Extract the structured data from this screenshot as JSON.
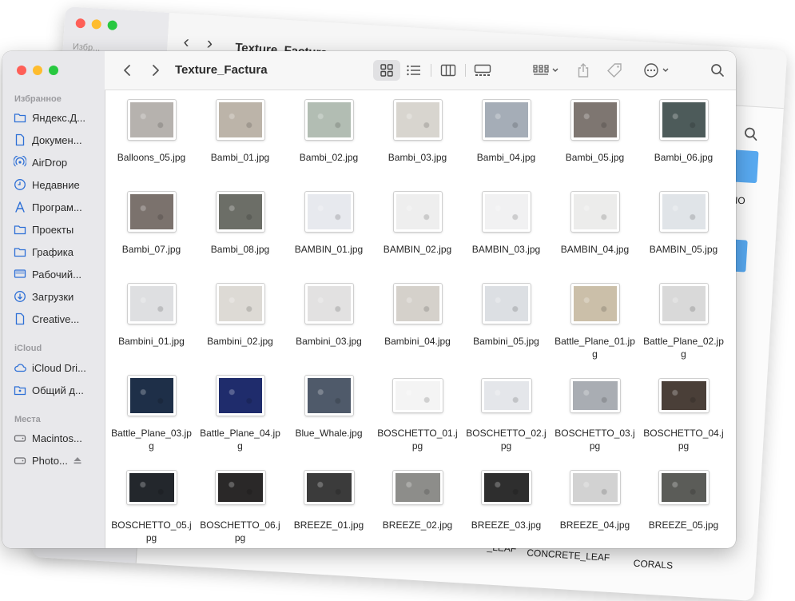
{
  "background_window": {
    "title": "Texture_Factura",
    "sidebar_label": "Избр...",
    "labels": [
      ".MIO",
      "CONCRETE_LEAF",
      "CORALS",
      "_LEAF"
    ]
  },
  "window": {
    "title": "Texture_Factura"
  },
  "sidebar": {
    "favorites_header": "Избранное",
    "favorites": [
      {
        "label": "Яндекс.Д...",
        "icon": "folder-icon"
      },
      {
        "label": "Докумен...",
        "icon": "document-icon"
      },
      {
        "label": "AirDrop",
        "icon": "airdrop-icon"
      },
      {
        "label": "Недавние",
        "icon": "clock-icon"
      },
      {
        "label": "Програм...",
        "icon": "applications-icon"
      },
      {
        "label": "Проекты",
        "icon": "folder-icon"
      },
      {
        "label": "Графика",
        "icon": "folder-icon"
      },
      {
        "label": "Рабочий...",
        "icon": "desktop-icon"
      },
      {
        "label": "Загрузки",
        "icon": "download-icon"
      },
      {
        "label": "Creative...",
        "icon": "document-icon"
      }
    ],
    "icloud_header": "iCloud",
    "icloud": [
      {
        "label": "iCloud Dri...",
        "icon": "cloud-icon"
      },
      {
        "label": "Общий д...",
        "icon": "shared-folder-icon"
      }
    ],
    "places_header": "Места",
    "places": [
      {
        "label": "Macintos...",
        "icon": "disk-icon"
      },
      {
        "label": "Photo...",
        "icon": "disk-icon"
      }
    ]
  },
  "files": [
    {
      "name": "Balloons_05.jpg",
      "color": "#b6b2ae"
    },
    {
      "name": "Bambi_01.jpg",
      "color": "#bcb4a9"
    },
    {
      "name": "Bambi_02.jpg",
      "color": "#b2bdb3"
    },
    {
      "name": "Bambi_03.jpg",
      "color": "#d8d5cf"
    },
    {
      "name": "Bambi_04.jpg",
      "color": "#a5adb7"
    },
    {
      "name": "Bambi_05.jpg",
      "color": "#7e7671"
    },
    {
      "name": "Bambi_06.jpg",
      "color": "#4d5b5a"
    },
    {
      "name": "Bambi_07.jpg",
      "color": "#7b726d"
    },
    {
      "name": "Bambi_08.jpg",
      "color": "#6c6e67"
    },
    {
      "name": "BAMBIN_01.jpg",
      "color": "#e7e9ee"
    },
    {
      "name": "BAMBIN_02.jpg",
      "color": "#eeeeee"
    },
    {
      "name": "BAMBIN_03.jpg",
      "color": "#f1f1f2"
    },
    {
      "name": "BAMBIN_04.jpg",
      "color": "#ececeb"
    },
    {
      "name": "BAMBIN_05.jpg",
      "color": "#e0e4e8"
    },
    {
      "name": "Bambini_01.jpg",
      "color": "#dedfe1"
    },
    {
      "name": "Bambini_02.jpg",
      "color": "#dddad5"
    },
    {
      "name": "Bambini_03.jpg",
      "color": "#e2e1e1"
    },
    {
      "name": "Bambini_04.jpg",
      "color": "#d5d1cb"
    },
    {
      "name": "Bambini_05.jpg",
      "color": "#dcdfe3"
    },
    {
      "name": "Battle_Plane_01.jpg",
      "color": "#cbbfa9"
    },
    {
      "name": "Battle_Plane_02.jpg",
      "color": "#d9d9d9"
    },
    {
      "name": "Battle_Plane_03.jpg",
      "color": "#1e2f48"
    },
    {
      "name": "Battle_Plane_04.jpg",
      "color": "#1f2c6c"
    },
    {
      "name": "Blue_Whale.jpg",
      "color": "#4f5a6a"
    },
    {
      "name": "BOSCHETTO_01.jpg",
      "color": "#f4f4f4"
    },
    {
      "name": "BOSCHETTO_02.jpg",
      "color": "#e4e6ea"
    },
    {
      "name": "BOSCHETTO_03.jpg",
      "color": "#a9adb3"
    },
    {
      "name": "BOSCHETTO_04.jpg",
      "color": "#4a3f38"
    },
    {
      "name": "BOSCHETTO_05.jpg",
      "color": "#23272c"
    },
    {
      "name": "BOSCHETTO_06.jpg",
      "color": "#2a2828"
    },
    {
      "name": "BREEZE_01.jpg",
      "color": "#3b3b3b"
    },
    {
      "name": "BREEZE_02.jpg",
      "color": "#8d8d8a"
    },
    {
      "name": "BREEZE_03.jpg",
      "color": "#2e2e2e"
    },
    {
      "name": "BREEZE_04.jpg",
      "color": "#d2d2d2"
    },
    {
      "name": "BREEZE_05.jpg",
      "color": "#5b5c58"
    }
  ]
}
